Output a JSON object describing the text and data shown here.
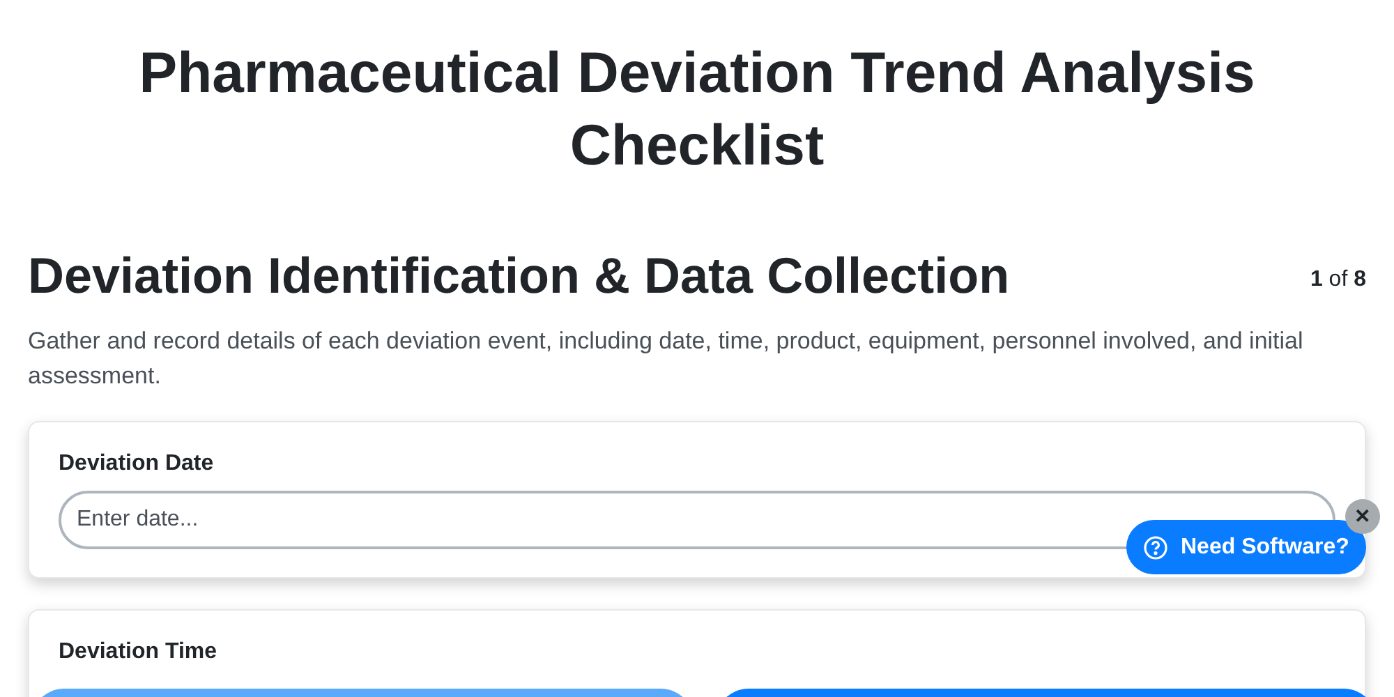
{
  "title": "Pharmaceutical Deviation Trend Analysis Checklist",
  "section": {
    "heading": "Deviation Identification & Data Collection",
    "counter": "**1** of **8**",
    "description": "Gather and record details of each deviation event, including date, time, product, equipment, personnel involved, and initial assessment."
  },
  "fields": [
    {
      "label": "Deviation Date",
      "placeholder": "Enter date..."
    },
    {
      "label": "Deviation Time"
    }
  ],
  "nav_buttons": [
    {
      "disabled": true
    },
    {
      "disabled": false
    }
  ],
  "help_widget": {
    "label": "Need Software?",
    "close": "✕"
  }
}
